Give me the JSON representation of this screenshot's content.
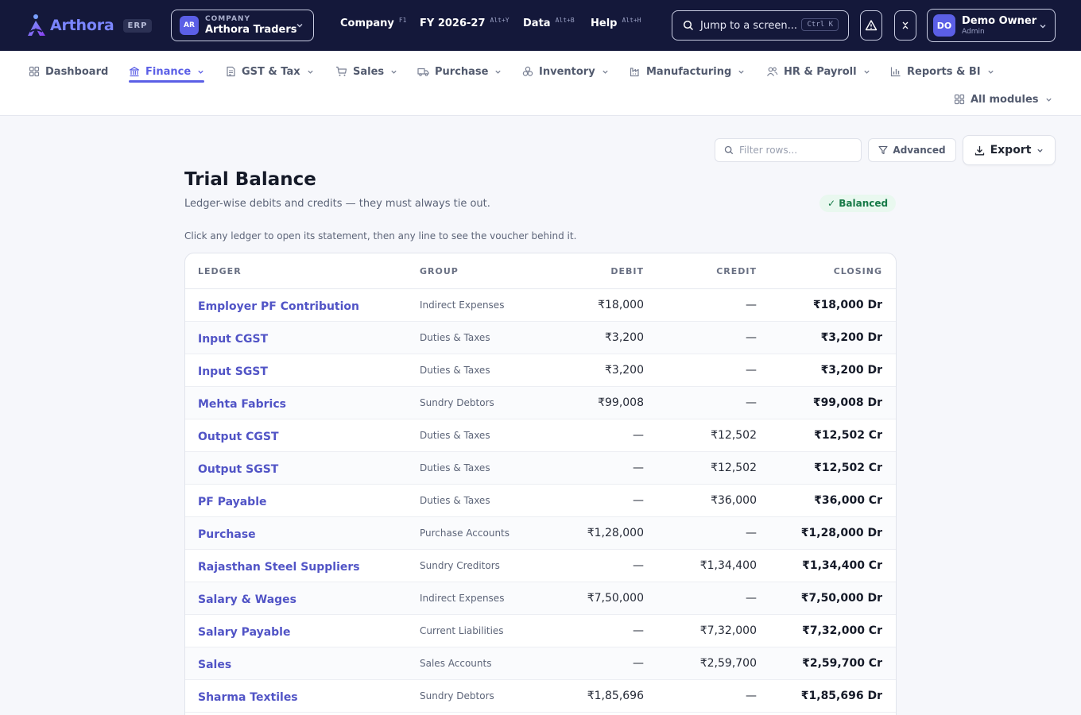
{
  "app": {
    "brand": "Arthora",
    "brand_tag": "ERP",
    "company_caption": "COMPANY",
    "company_avatar": "AR",
    "company_name": "Arthora Traders",
    "menus": [
      {
        "label": "Company",
        "shortcut": "F1"
      },
      {
        "label": "FY 2026-27",
        "shortcut": "Alt+Y"
      },
      {
        "label": "Data",
        "shortcut": "Alt+B"
      },
      {
        "label": "Help",
        "shortcut": "Alt+H"
      }
    ],
    "search_label": "Jump to a screen...",
    "search_shortcut": "Ctrl K",
    "user_avatar": "DO",
    "user_name": "Demo Owner",
    "user_role": "Admin",
    "colors": {
      "topbar": "#14183a",
      "accent": "#5b5fe6",
      "link": "#5154c6",
      "success": "#177a47"
    }
  },
  "nav": {
    "items": [
      {
        "label": "Dashboard",
        "icon": "grid-icon"
      },
      {
        "label": "Finance",
        "icon": "bank-icon",
        "active": true
      },
      {
        "label": "GST & Tax",
        "icon": "document-icon"
      },
      {
        "label": "Sales",
        "icon": "cart-icon"
      },
      {
        "label": "Purchase",
        "icon": "truck-icon"
      },
      {
        "label": "Inventory",
        "icon": "boxes-icon"
      },
      {
        "label": "Manufacturing",
        "icon": "factory-icon"
      },
      {
        "label": "HR & Payroll",
        "icon": "people-icon"
      },
      {
        "label": "Reports & BI",
        "icon": "bar-chart-icon"
      },
      {
        "label": "All modules",
        "icon": "grid-icon"
      }
    ]
  },
  "toolbar": {
    "filter_placeholder": "Filter rows...",
    "advanced_label": "Advanced",
    "export_label": "Export"
  },
  "page": {
    "title": "Trial Balance",
    "subtitle": "Ledger-wise debits and credits — they must always tie out.",
    "status": "✓ Balanced",
    "hint": "Click any ledger to open its statement, then any line to see the voucher behind it."
  },
  "table": {
    "headers": {
      "ledger": "LEDGER",
      "group": "GROUP",
      "debit": "DEBIT",
      "credit": "CREDIT",
      "closing": "CLOSING"
    },
    "rows": [
      {
        "ledger": "Employer PF Contribution",
        "group": "Indirect Expenses",
        "debit": "₹18,000",
        "credit": "—",
        "closing": "₹18,000 Dr"
      },
      {
        "ledger": "Input CGST",
        "group": "Duties & Taxes",
        "debit": "₹3,200",
        "credit": "—",
        "closing": "₹3,200 Dr"
      },
      {
        "ledger": "Input SGST",
        "group": "Duties & Taxes",
        "debit": "₹3,200",
        "credit": "—",
        "closing": "₹3,200 Dr"
      },
      {
        "ledger": "Mehta Fabrics",
        "group": "Sundry Debtors",
        "debit": "₹99,008",
        "credit": "—",
        "closing": "₹99,008 Dr"
      },
      {
        "ledger": "Output CGST",
        "group": "Duties & Taxes",
        "debit": "—",
        "credit": "₹12,502",
        "closing": "₹12,502 Cr"
      },
      {
        "ledger": "Output SGST",
        "group": "Duties & Taxes",
        "debit": "—",
        "credit": "₹12,502",
        "closing": "₹12,502 Cr"
      },
      {
        "ledger": "PF Payable",
        "group": "Duties & Taxes",
        "debit": "—",
        "credit": "₹36,000",
        "closing": "₹36,000 Cr"
      },
      {
        "ledger": "Purchase",
        "group": "Purchase Accounts",
        "debit": "₹1,28,000",
        "credit": "—",
        "closing": "₹1,28,000 Dr"
      },
      {
        "ledger": "Rajasthan Steel Suppliers",
        "group": "Sundry Creditors",
        "debit": "—",
        "credit": "₹1,34,400",
        "closing": "₹1,34,400 Cr"
      },
      {
        "ledger": "Salary & Wages",
        "group": "Indirect Expenses",
        "debit": "₹7,50,000",
        "credit": "—",
        "closing": "₹7,50,000 Dr"
      },
      {
        "ledger": "Salary Payable",
        "group": "Current Liabilities",
        "debit": "—",
        "credit": "₹7,32,000",
        "closing": "₹7,32,000 Cr"
      },
      {
        "ledger": "Sales",
        "group": "Sales Accounts",
        "debit": "—",
        "credit": "₹2,59,700",
        "closing": "₹2,59,700 Cr"
      },
      {
        "ledger": "Sharma Textiles",
        "group": "Sundry Debtors",
        "debit": "₹1,85,696",
        "credit": "—",
        "closing": "₹1,85,696 Dr"
      }
    ]
  }
}
